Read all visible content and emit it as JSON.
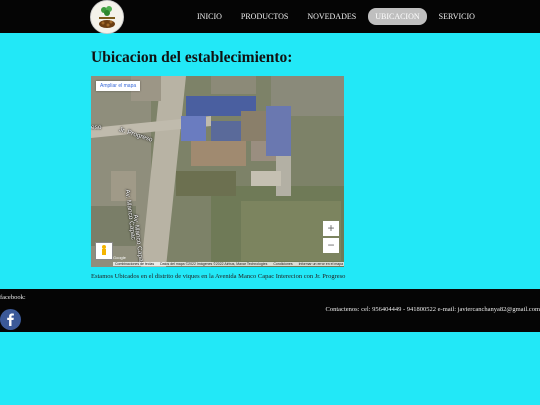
{
  "nav": {
    "items": [
      {
        "label": "INICIO",
        "active": false
      },
      {
        "label": "PRODUCTOS",
        "active": false
      },
      {
        "label": "NOVEDADES",
        "active": false
      },
      {
        "label": "UBICACION",
        "active": true
      },
      {
        "label": "SERVICIO",
        "active": false
      }
    ]
  },
  "main": {
    "title": "Ubicacion del establecimiento:",
    "caption": "Estamos Ubicados en el distrito de viques en la Avenida Manco Capac Interecion con Jr. Progreso"
  },
  "map": {
    "enlarge_label": "Ampliar el mapa",
    "streets": [
      "eso",
      "Jr. Progreso",
      "Av. Manco Capac",
      "Av. Manco Capac"
    ],
    "zoom_in": "+",
    "zoom_out": "−",
    "google_mark": "Google",
    "footer": [
      "Combinaciones de teclas",
      "Datos del mapa ©2022 Imágenes ©2022 Airbus, Maxar Technologies",
      "Condiciones",
      "Informar un error en el mapa"
    ]
  },
  "footer": {
    "facebook_label": "facebook:",
    "contact": "Contactenos: cel: 956404449 - 941800522 e-mail: javiercanchanya82@gmail.com"
  },
  "colors": {
    "page_bg": "#22e8f7",
    "bar_bg": "#050505",
    "active_tab": "#bfbfbf",
    "facebook_blue": "#3b5998"
  },
  "icons": {
    "logo": "brand-logo",
    "facebook": "facebook-icon",
    "pegman": "pegman-icon"
  }
}
